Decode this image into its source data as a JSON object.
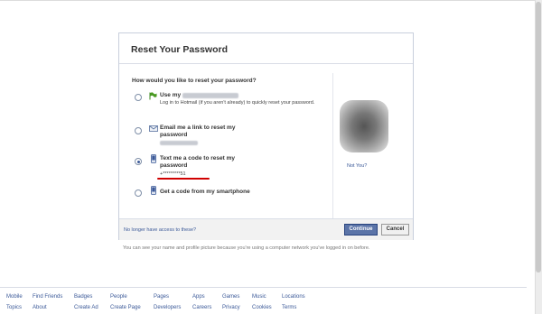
{
  "dialog": {
    "title": "Reset Your Password",
    "question": "How would you like to reset your password?",
    "options": [
      {
        "title_prefix": "Use my",
        "subtitle": "Log in to Hotmail (if you aren't already) to quickly reset your password.",
        "icon": "hotmail-flag-icon",
        "checked": false
      },
      {
        "title": "Email me a link to reset my password",
        "icon": "envelope-icon",
        "checked": false
      },
      {
        "title": "Text me a code to reset my password",
        "detail": "+*********51",
        "icon": "phone-icon",
        "checked": true
      },
      {
        "title": "Get a code from my smartphone",
        "icon": "phone-icon",
        "checked": false
      }
    ],
    "not_you": "Not You?",
    "no_access": "No longer have access to these?",
    "continue_label": "Continue",
    "cancel_label": "Cancel"
  },
  "info_note": "You can see your name and profile picture because you're using a computer network you've logged in on before.",
  "footer": {
    "row1": [
      "Mobile",
      "Find Friends",
      "Badges",
      "People",
      "Pages",
      "Apps",
      "Games",
      "Music",
      "Locations"
    ],
    "row2": [
      "Topics",
      "About",
      "Create Ad",
      "Create Page",
      "Developers",
      "Careers",
      "Privacy",
      "Cookies",
      "Terms"
    ]
  },
  "colors": {
    "accent": "#3b5998",
    "button": "#5b74a8",
    "underline": "#d00000"
  }
}
